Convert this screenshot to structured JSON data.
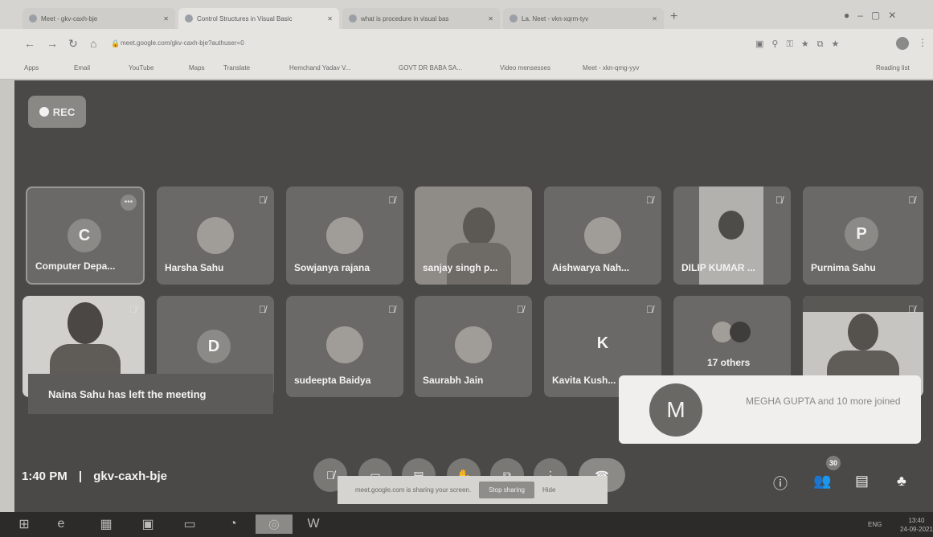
{
  "browser": {
    "tabs": [
      {
        "title": "Meet - gkv-caxh-bje",
        "active": false
      },
      {
        "title": "Control Structures in Visual Basic",
        "active": true
      },
      {
        "title": "what is procedure in visual bas",
        "active": false
      },
      {
        "title": "La. Neet - vkn-xqrm-tyv",
        "active": false
      }
    ],
    "new_tab": "+",
    "url": "meet.google.com/gkv-caxh-bje?authuser=0",
    "bookmarks": [
      "Apps",
      "Email",
      "YouTube",
      "Maps",
      "Translate",
      "Hemchand Yadav V...",
      "GOVT DR BABA SA...",
      "Video mensesses",
      "Meet - xkn-qmg-yyv"
    ],
    "reading_list": "Reading list"
  },
  "meet": {
    "rec_label": "REC",
    "participants": [
      {
        "name": "Computer Depa...",
        "avatar": "C",
        "kind": "letter"
      },
      {
        "name": "Harsha Sahu",
        "kind": "photo"
      },
      {
        "name": "Sowjanya rajana",
        "kind": "photo"
      },
      {
        "name": "sanjay singh p...",
        "kind": "video"
      },
      {
        "name": "Aishwarya Nah...",
        "kind": "photo"
      },
      {
        "name": "DILIP KUMAR ...",
        "kind": "video"
      },
      {
        "name": "Purnima Sahu",
        "avatar": "P",
        "kind": "letter"
      },
      {
        "name": "",
        "kind": "video"
      },
      {
        "name": "",
        "avatar": "D",
        "kind": "letter"
      },
      {
        "name": "sudeepta Baidya",
        "kind": "photo"
      },
      {
        "name": "Saurabh Jain",
        "kind": "photo"
      },
      {
        "name": "Kavita Kush...",
        "avatar": "K",
        "kind": "letter"
      },
      {
        "name": "17 others",
        "kind": "others"
      },
      {
        "name": "",
        "kind": "video"
      }
    ],
    "left_toast": "Naina Sahu has left the meeting",
    "join_toast": {
      "avatar": "M",
      "text": "MEGHA GUPTA and 10 more joined"
    },
    "time": "1:40 PM",
    "separator": "|",
    "meeting_code": "gkv-caxh-bje",
    "participant_count": "30",
    "share_bar": {
      "text": "meet.google.com is sharing your screen.",
      "stop": "Stop sharing",
      "hide": "Hide"
    }
  },
  "taskbar": {
    "lang": "ENG",
    "clock_time": "13:40",
    "clock_date": "24-09-2021"
  }
}
